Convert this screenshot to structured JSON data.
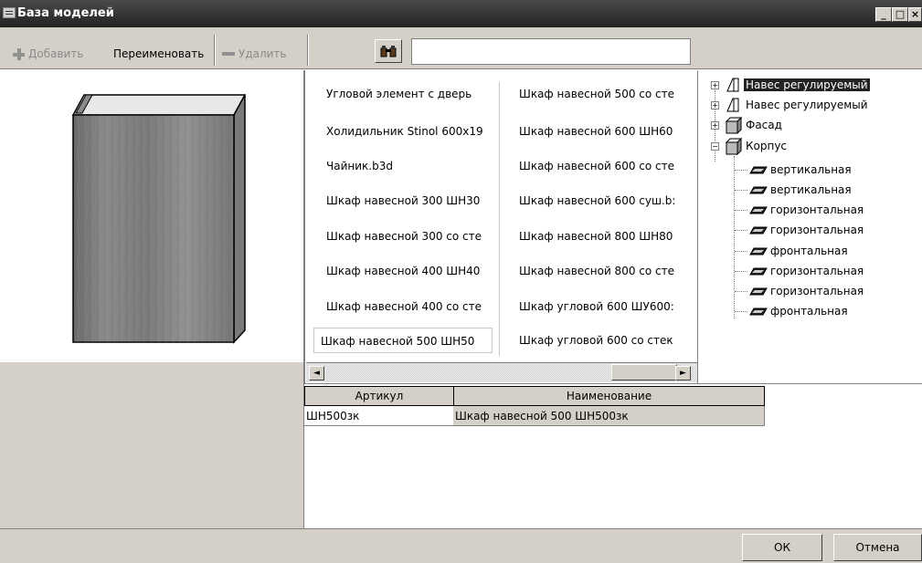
{
  "window": {
    "title": "База моделей",
    "controls": {
      "minimize": "_",
      "maximize": "□",
      "close": "×"
    }
  },
  "toolbar": {
    "add_label": "Добавить",
    "rename_label": "Переименовать",
    "delete_label": "Удалить",
    "search_value": ""
  },
  "models": [
    "Угловой элемент с дверь",
    "Холидильник Stinol 600x19",
    "Чайник.b3d",
    "Шкаф навесной 300 ШН30",
    "Шкаф навесной 300 со сте",
    "Шкаф навесной 400 ШН40",
    "Шкаф навесной 400 со сте",
    "Шкаф навесной 500 ШН50",
    "Шкаф навесной 500 со сте",
    "Шкаф навесной 600 ШН60",
    "Шкаф навесной 600 со сте",
    "Шкаф навесной 600 суш.b:",
    "Шкаф навесной 800 ШН80",
    "Шкаф навесной 800 со сте",
    "Шкаф угловой 600 ШУ600:",
    "Шкаф угловой 600 со стек"
  ],
  "tree": [
    {
      "label": "Навес регулируемый",
      "expander": "+",
      "icon": "hinge-icon",
      "level": 0,
      "selected": true
    },
    {
      "label": "Навес регулируемый",
      "expander": "+",
      "icon": "hinge-icon",
      "level": 0
    },
    {
      "label": "Фасад",
      "expander": "+",
      "icon": "box-icon",
      "level": 0
    },
    {
      "label": "Корпус",
      "expander": "−",
      "icon": "box-icon",
      "level": 0
    },
    {
      "label": "вертикальная",
      "icon": "panel-icon",
      "level": 1
    },
    {
      "label": "вертикальная",
      "icon": "panel-icon",
      "level": 1
    },
    {
      "label": "горизонтальная",
      "icon": "panel-icon",
      "level": 1
    },
    {
      "label": "горизонтальная",
      "icon": "panel-icon",
      "level": 1
    },
    {
      "label": "фронтальная",
      "icon": "panel-icon",
      "level": 1
    },
    {
      "label": "горизонтальная",
      "icon": "panel-icon",
      "level": 1
    },
    {
      "label": "горизонтальная",
      "icon": "panel-icon",
      "level": 1
    },
    {
      "label": "фронтальная",
      "icon": "panel-icon",
      "level": 1
    }
  ],
  "grid": {
    "headers": [
      "Артикул",
      "Наименование"
    ],
    "rows": [
      [
        "ШН500зк",
        "Шкаф навесной 500 ШН500зк"
      ]
    ]
  },
  "buttons": {
    "ok": "ОК",
    "cancel": "Отмена"
  }
}
